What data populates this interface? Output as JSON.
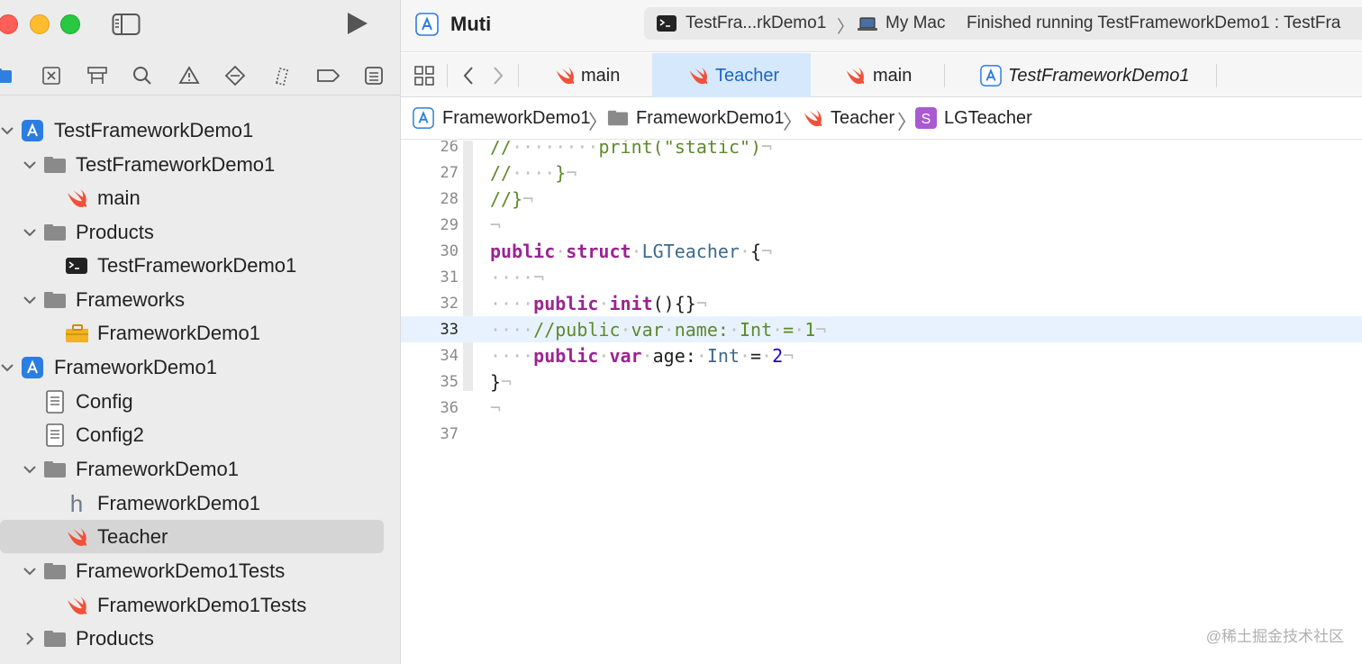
{
  "window": {
    "app_name": "Muti",
    "scheme_target": "TestFra...rkDemo1",
    "device": "My Mac",
    "status": "Finished running TestFrameworkDemo1 : TestFra",
    "colors": {
      "accent": "#1a66c2",
      "selected_tab_bg": "#d6e8fb",
      "keyword": "#9b2393",
      "comment": "#5d8a2a",
      "type": "#3e6a8c"
    }
  },
  "navigator": {
    "toolbar_icons": [
      "folder-icon",
      "source-control-icon",
      "symbol-icon",
      "find-icon",
      "issue-icon",
      "test-icon",
      "debug-icon",
      "breakpoint-icon",
      "report-icon"
    ],
    "items": [
      {
        "label": "TestFrameworkDemo1",
        "icon": "app-project-icon",
        "level": 0,
        "expanded": true
      },
      {
        "label": "TestFrameworkDemo1",
        "icon": "folder-icon",
        "level": 1,
        "expanded": true
      },
      {
        "label": "main",
        "icon": "swift-icon",
        "level": 2
      },
      {
        "label": "Products",
        "icon": "folder-icon",
        "level": 1,
        "expanded": true
      },
      {
        "label": "TestFrameworkDemo1",
        "icon": "terminal-icon",
        "level": 2
      },
      {
        "label": "Frameworks",
        "icon": "folder-icon",
        "level": 1,
        "expanded": true
      },
      {
        "label": "FrameworkDemo1",
        "icon": "toolbox-icon",
        "level": 2
      },
      {
        "label": "FrameworkDemo1",
        "icon": "app-project-icon",
        "level": 0,
        "expanded": true
      },
      {
        "label": "Config",
        "icon": "file-icon",
        "level": 1
      },
      {
        "label": "Config2",
        "icon": "file-icon",
        "level": 1
      },
      {
        "label": "FrameworkDemo1",
        "icon": "folder-icon",
        "level": 1,
        "expanded": true
      },
      {
        "label": "FrameworkDemo1",
        "icon": "header-icon",
        "level": 2
      },
      {
        "label": "Teacher",
        "icon": "swift-icon",
        "level": 2,
        "selected": true
      },
      {
        "label": "FrameworkDemo1Tests",
        "icon": "folder-icon",
        "level": 1,
        "expanded": true
      },
      {
        "label": "FrameworkDemo1Tests",
        "icon": "swift-icon",
        "level": 2
      },
      {
        "label": "Products",
        "icon": "folder-icon",
        "level": 1,
        "expanded": false
      }
    ]
  },
  "tabs": [
    {
      "label": "main",
      "icon": "swift-icon"
    },
    {
      "label": "Teacher",
      "icon": "swift-icon",
      "active": true
    },
    {
      "label": "main",
      "icon": "swift-icon"
    },
    {
      "label": "TestFrameworkDemo1",
      "icon": "app-project-icon"
    }
  ],
  "jumpbar": [
    "FrameworkDemo1",
    "FrameworkDemo1",
    "Teacher",
    "LGTeacher"
  ],
  "editor": {
    "current_line": 33,
    "lines": [
      {
        "n": "26",
        "code": "//········print(\"static\")¬"
      },
      {
        "n": "27",
        "code": "//····}¬"
      },
      {
        "n": "28",
        "code": "//}¬"
      },
      {
        "n": "29",
        "code": "¬"
      },
      {
        "n": "30",
        "code": "public·struct·LGTeacher·{¬"
      },
      {
        "n": "31",
        "code": "····¬"
      },
      {
        "n": "32",
        "code": "····public·init(){}¬"
      },
      {
        "n": "33",
        "code": "····//public·var·name:·Int·=·1¬"
      },
      {
        "n": "34",
        "code": "····public·var·age:·Int·=·2¬"
      },
      {
        "n": "35",
        "code": "}¬"
      },
      {
        "n": "36",
        "code": "¬"
      },
      {
        "n": "37",
        "code": ""
      }
    ]
  },
  "watermark": "@稀土掘金技术社区"
}
